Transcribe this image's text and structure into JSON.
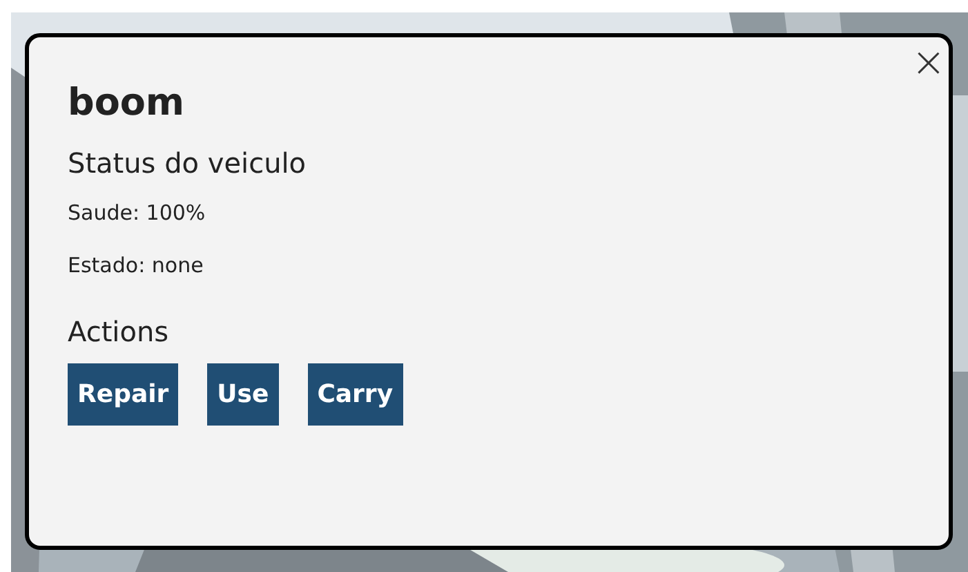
{
  "dialog": {
    "title": "boom",
    "close": "×",
    "section": "Status do veiculo",
    "stats": [
      "Saude: 100%",
      "Estado: none"
    ],
    "actions_heading": "Actions",
    "actions": [
      "Repair",
      "Use",
      "Carry"
    ]
  }
}
